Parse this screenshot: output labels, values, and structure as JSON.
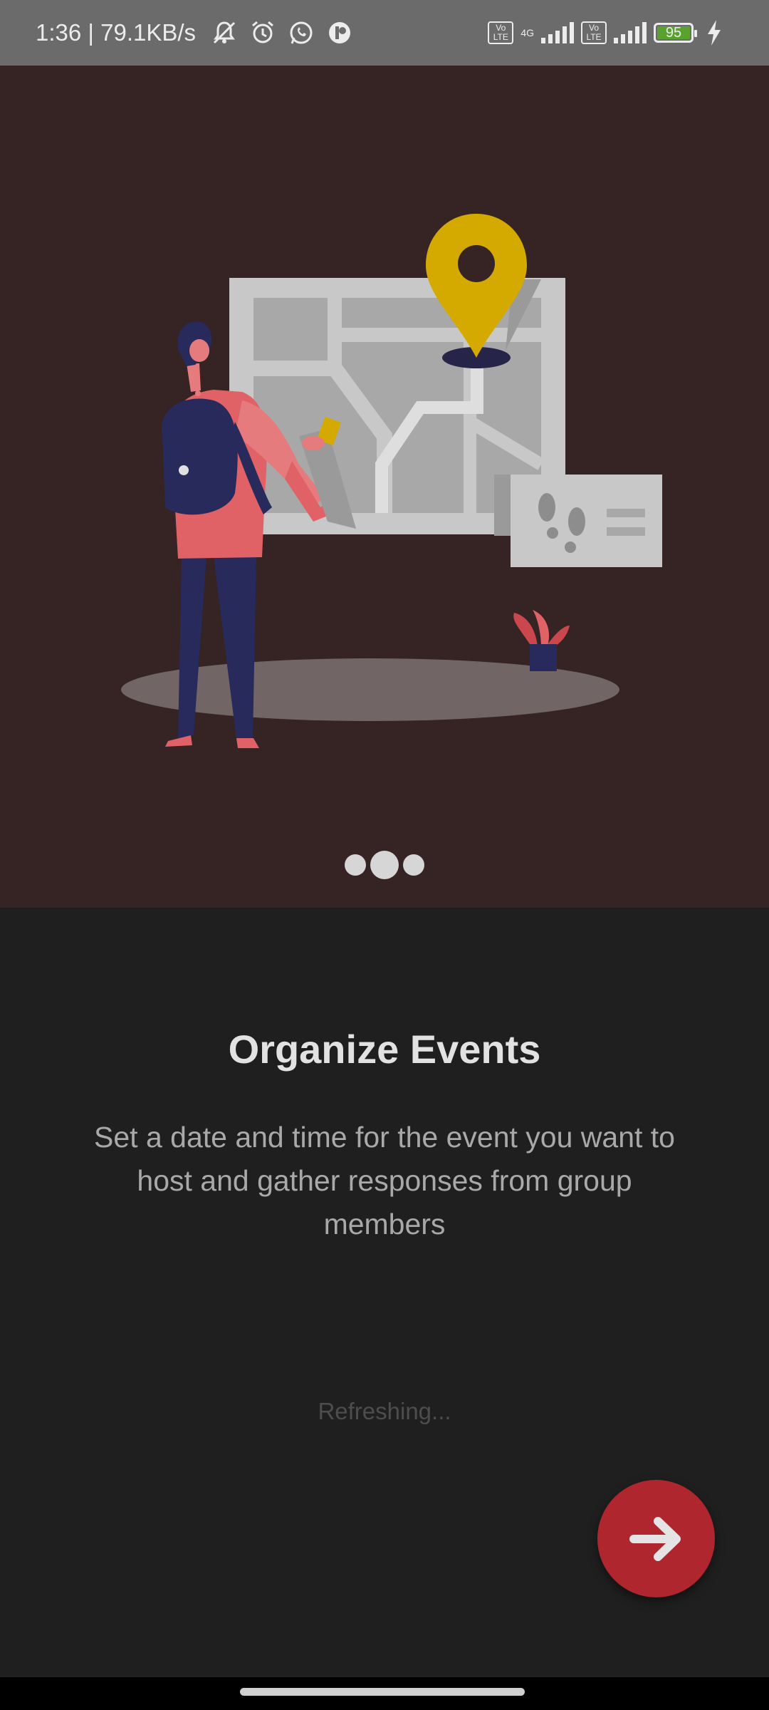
{
  "status_bar": {
    "time_speed": "1:36 | 79.1KB/s",
    "network_type": "4G",
    "volte_label": "Vo LTE",
    "battery": "95"
  },
  "onboarding": {
    "title": "Organize Events",
    "description": "Set a date and time for the event you want to host and gather responses from group members",
    "status": "Refreshing...",
    "current_page": 2,
    "total_pages": 3
  },
  "colors": {
    "hero_bg": "#362323",
    "page_bg": "#1f1f1f",
    "accent": "#b0262f",
    "pin": "#d4aa00"
  },
  "icons": {
    "next": "arrow-right-icon",
    "bell_off": "bell-off-icon",
    "alarm": "alarm-icon",
    "whatsapp": "whatsapp-icon",
    "app": "app-icon",
    "charging": "lightning-icon"
  }
}
